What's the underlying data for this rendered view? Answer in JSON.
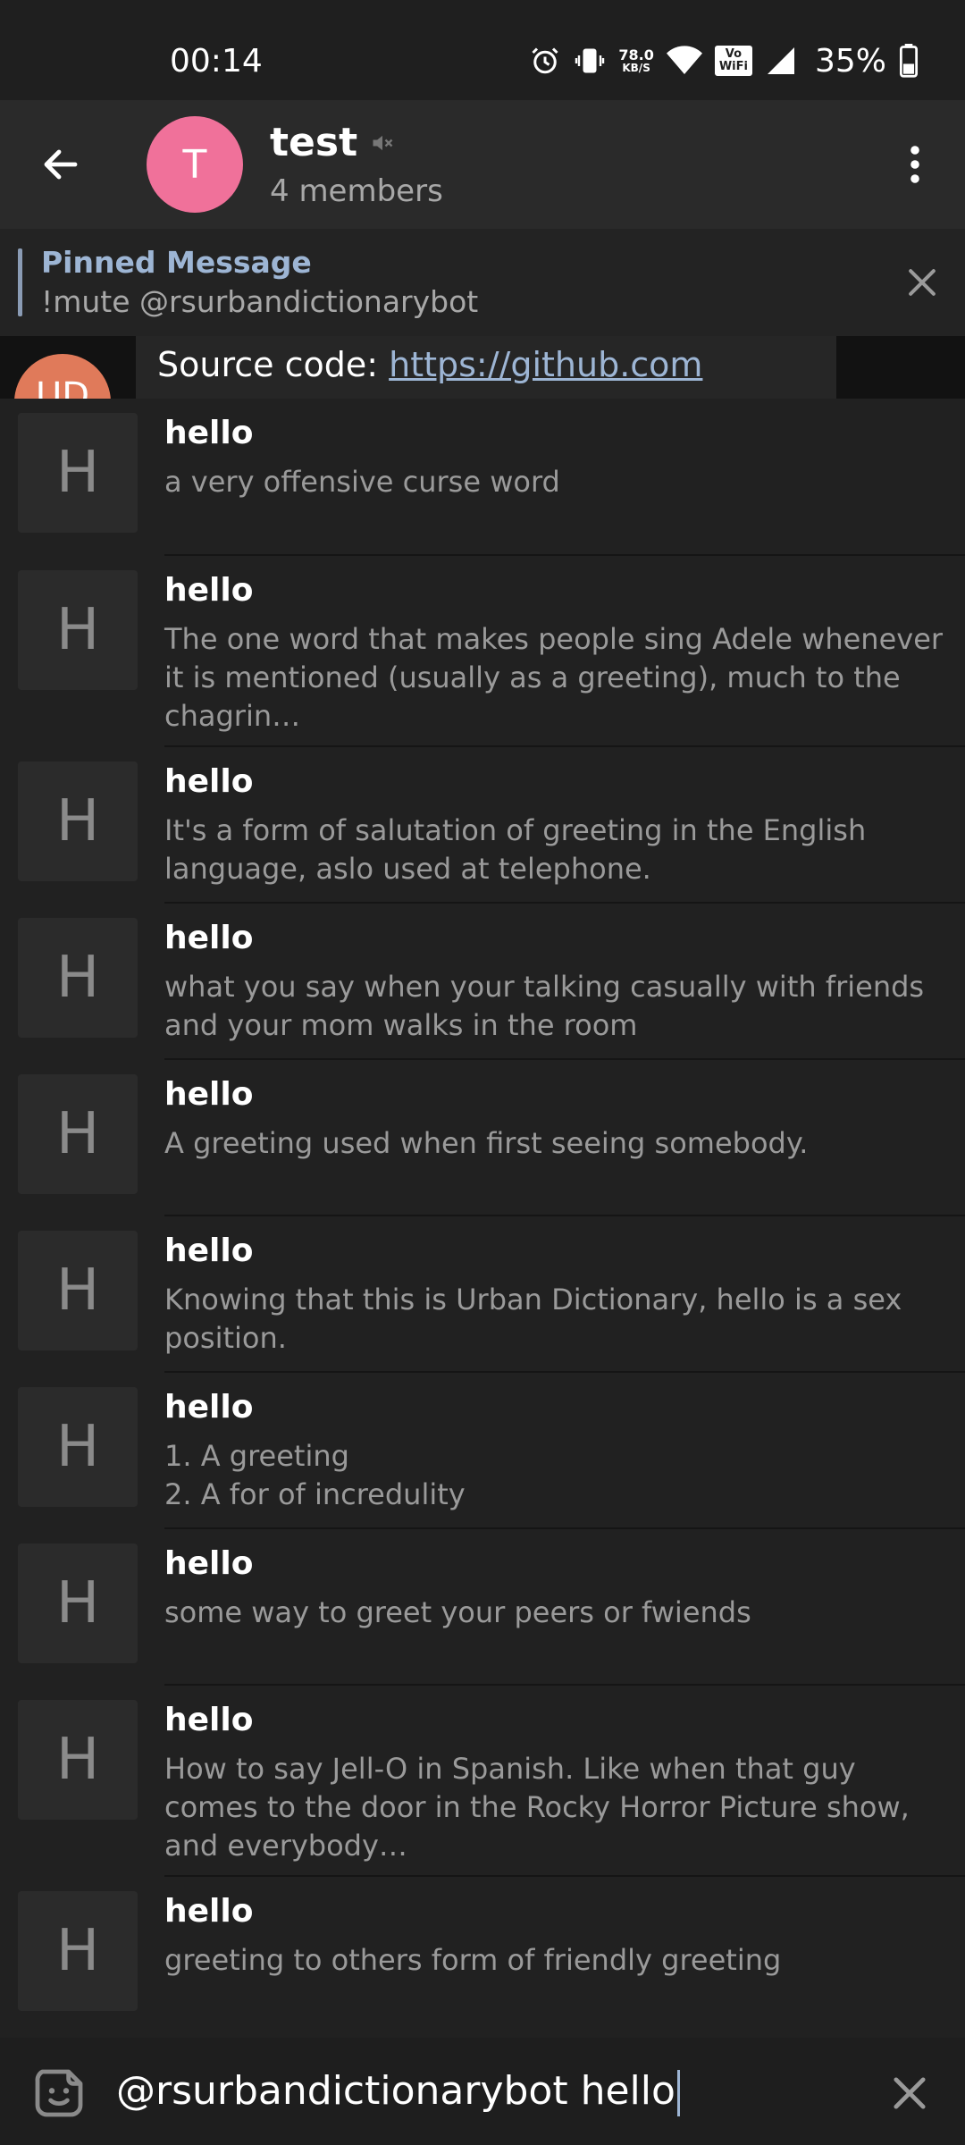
{
  "status_bar": {
    "time": "00:14",
    "net_speed_value": "78.0",
    "net_speed_unit": "KB/S",
    "vowifi_label_top": "Vo",
    "vowifi_label_bottom": "WiFi",
    "battery": "35%",
    "icons": [
      "alarm-icon",
      "vibrate-icon",
      "wifi-icon",
      "signal-icon",
      "battery-icon"
    ]
  },
  "header": {
    "title": "test",
    "subtitle": "4 members",
    "avatar_letter": "T",
    "avatar_color": "#f0719a",
    "muted": true
  },
  "pinned": {
    "title": "Pinned Message",
    "text": "!mute @rsurbandictionarybot"
  },
  "peek_message": {
    "avatar_letter": "UD",
    "text_prefix": "Source code: ",
    "link": "https://github.com"
  },
  "results": [
    {
      "thumb": "H",
      "title": "hello",
      "description": "a very offensive curse word"
    },
    {
      "thumb": "H",
      "title": "hello",
      "description": "The one word that makes people sing Adele whenever it is mentioned (usually as a greeting), much to the chagrin…"
    },
    {
      "thumb": "H",
      "title": "hello",
      "description": "It's a form of salutation of greeting in the English language, aslo used at telephone."
    },
    {
      "thumb": "H",
      "title": "hello",
      "description": "what you say when your talking casually with friends and your mom walks in the room"
    },
    {
      "thumb": "H",
      "title": "hello",
      "description": "A greeting used when first seeing somebody."
    },
    {
      "thumb": "H",
      "title": "hello",
      "description": "Knowing that this is Urban Dictionary, hello is a sex position."
    },
    {
      "thumb": "H",
      "title": "hello",
      "description": "1.  A greeting\n2.  A for of incredulity"
    },
    {
      "thumb": "H",
      "title": "hello",
      "description": "some way to greet your peers or fwiends"
    },
    {
      "thumb": "H",
      "title": "hello",
      "description": "How to say Jell-O in Spanish. Like when that guy comes to the door in the Rocky Horror Picture show, and everybody…"
    },
    {
      "thumb": "H",
      "title": "hello",
      "description": "greeting to others form of friendly greeting"
    }
  ],
  "input": {
    "value": "@rsurbandictionarybot hello"
  },
  "colors": {
    "accent": "#9db5d4",
    "background": "#212121",
    "app_bar": "#2a2a2a"
  }
}
